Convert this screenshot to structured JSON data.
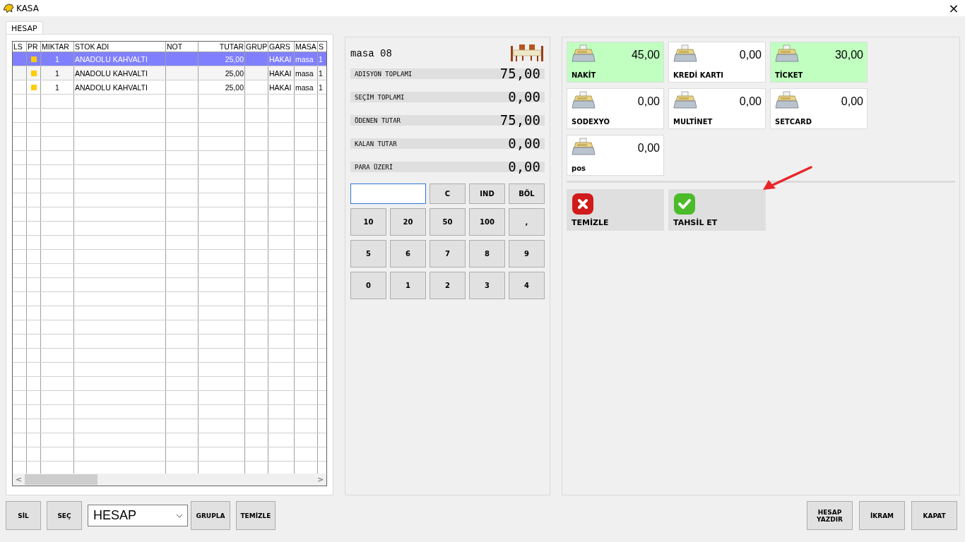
{
  "window": {
    "title": "KASA",
    "close": "×"
  },
  "tabs": [
    {
      "label": "HESAP",
      "selected": true
    }
  ],
  "table": {
    "columns": [
      "LS",
      "PR",
      "MIKTAR",
      "STOK ADI",
      "NOT",
      "TUTAR",
      "GRUP",
      "GARS",
      "MASA",
      "S"
    ],
    "rows": [
      {
        "selected": true,
        "pr": true,
        "cells": [
          "",
          "",
          "1",
          "ANADOLU KAHVALTI",
          "",
          "25,00",
          "",
          "HAKAI",
          "masa",
          "1"
        ]
      },
      {
        "selected": false,
        "pr": true,
        "cells": [
          "",
          "",
          "1",
          "ANADOLU KAHVALTI",
          "",
          "25,00",
          "",
          "HAKAI",
          "masa",
          "1"
        ]
      },
      {
        "selected": false,
        "pr": true,
        "cells": [
          "",
          "",
          "1",
          "ANADOLU KAHVALTI",
          "",
          "25,00",
          "",
          "HAKAI",
          "masa",
          "1"
        ]
      }
    ],
    "scroll_left": "<",
    "scroll_right": ">"
  },
  "table_name": "masa 08",
  "totals": [
    {
      "label": "ADISYON TOPLAMI",
      "value": "75,00"
    },
    {
      "label": "SEÇİM TOPLAMI",
      "value": "0,00"
    },
    {
      "label": "ÖDENEN TUTAR",
      "value": "75,00"
    },
    {
      "label": "KALAN TUTAR",
      "value": "0,00"
    },
    {
      "label": "PARA ÜZERİ",
      "value": "0,00"
    }
  ],
  "keypad": {
    "top_keys": [
      "C",
      "IND",
      "BÖL"
    ],
    "keys": [
      "10",
      "20",
      "50",
      "100",
      ",",
      "5",
      "6",
      "7",
      "8",
      "9",
      "0",
      "1",
      "2",
      "3",
      "4"
    ]
  },
  "payments": [
    {
      "name": "NAKİT",
      "amount": "45,00",
      "paid": true
    },
    {
      "name": "KREDİ KARTI",
      "amount": "0,00",
      "paid": false
    },
    {
      "name": "TİCKET",
      "amount": "30,00",
      "paid": true
    },
    {
      "name": "SODEXYO",
      "amount": "0,00",
      "paid": false
    },
    {
      "name": "MULTİNET",
      "amount": "0,00",
      "paid": false
    },
    {
      "name": "SETCARD",
      "amount": "0,00",
      "paid": false
    },
    {
      "name": "pos",
      "amount": "0,00",
      "paid": false
    }
  ],
  "actions": [
    {
      "label": "TEMİZLE",
      "kind": "clear"
    },
    {
      "label": "TAHSİL ET",
      "kind": "confirm"
    }
  ],
  "bottom_left": {
    "buttons_before": [
      "SİL",
      "SEÇ"
    ],
    "dropdown": "HESAP",
    "buttons_after": [
      "GRUPLA",
      "TEMİZLE"
    ]
  },
  "bottom_right": [
    "HESAP YAZDIR",
    "İKRAM",
    "KAPAT"
  ]
}
